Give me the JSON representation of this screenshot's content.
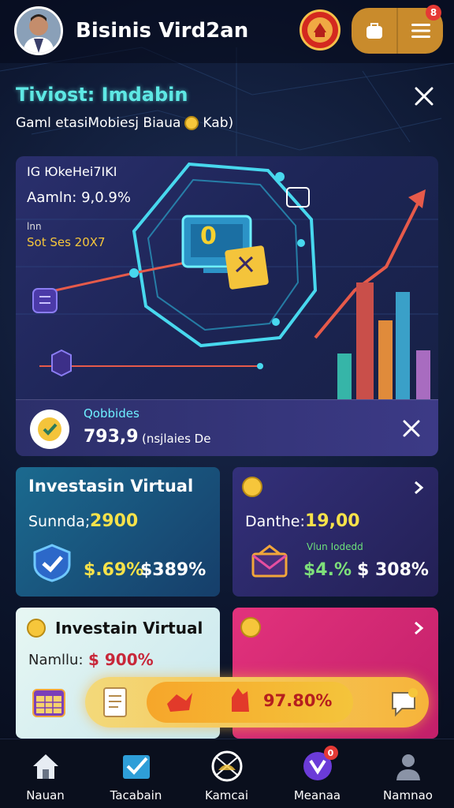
{
  "header": {
    "app_title": "Bisinis Vird2an",
    "notification_count": "8"
  },
  "promo": {
    "title": "Tiviost: Imdabin",
    "subtitle_prefix": "Gaml etasiMobiesj Biaua",
    "subtitle_suffix": "Kab)"
  },
  "hero": {
    "stat_label": "IG ЮkeHei7IKI",
    "stat_value": "Aamln: 9,0.9%",
    "stat_small": "lnn",
    "stat_date": "Sot Ses 20X7",
    "overlay_value": "0",
    "banner_caption": "Qobbides",
    "banner_value": "793,9",
    "banner_unit": "(nsjlaies De"
  },
  "cards": [
    {
      "title": "Investasin Virtual",
      "line_label": "Sunnda;",
      "line_value": "2900",
      "pct1": "$.69%",
      "pct2": "$389%"
    },
    {
      "title": "",
      "line_label": "Danthe:",
      "line_value": "19,00",
      "tagline": "Vlun Iodedd",
      "pct1": "$4.%",
      "pct2": "$ 308%"
    },
    {
      "title": "Investain Virtual",
      "line_label": "Namllu:",
      "line_value": "$ 900%"
    },
    {
      "title": ""
    }
  ],
  "floating_bar": {
    "value": "97.80%"
  },
  "nav": [
    {
      "label": "Nauan",
      "icon": "home-icon"
    },
    {
      "label": "Tacabain",
      "icon": "checklist-icon"
    },
    {
      "label": "Kamcai",
      "icon": "compass-icon"
    },
    {
      "label": "Meanaa",
      "icon": "wallet-icon",
      "badge": "0"
    },
    {
      "label": "Namnao",
      "icon": "profile-icon"
    }
  ],
  "colors": {
    "accent_cyan": "#5ee8e4",
    "gold": "#c98b2c",
    "card_teal": "#16557a",
    "card_purple": "#2d2c63",
    "card_pink": "#e2327c"
  }
}
